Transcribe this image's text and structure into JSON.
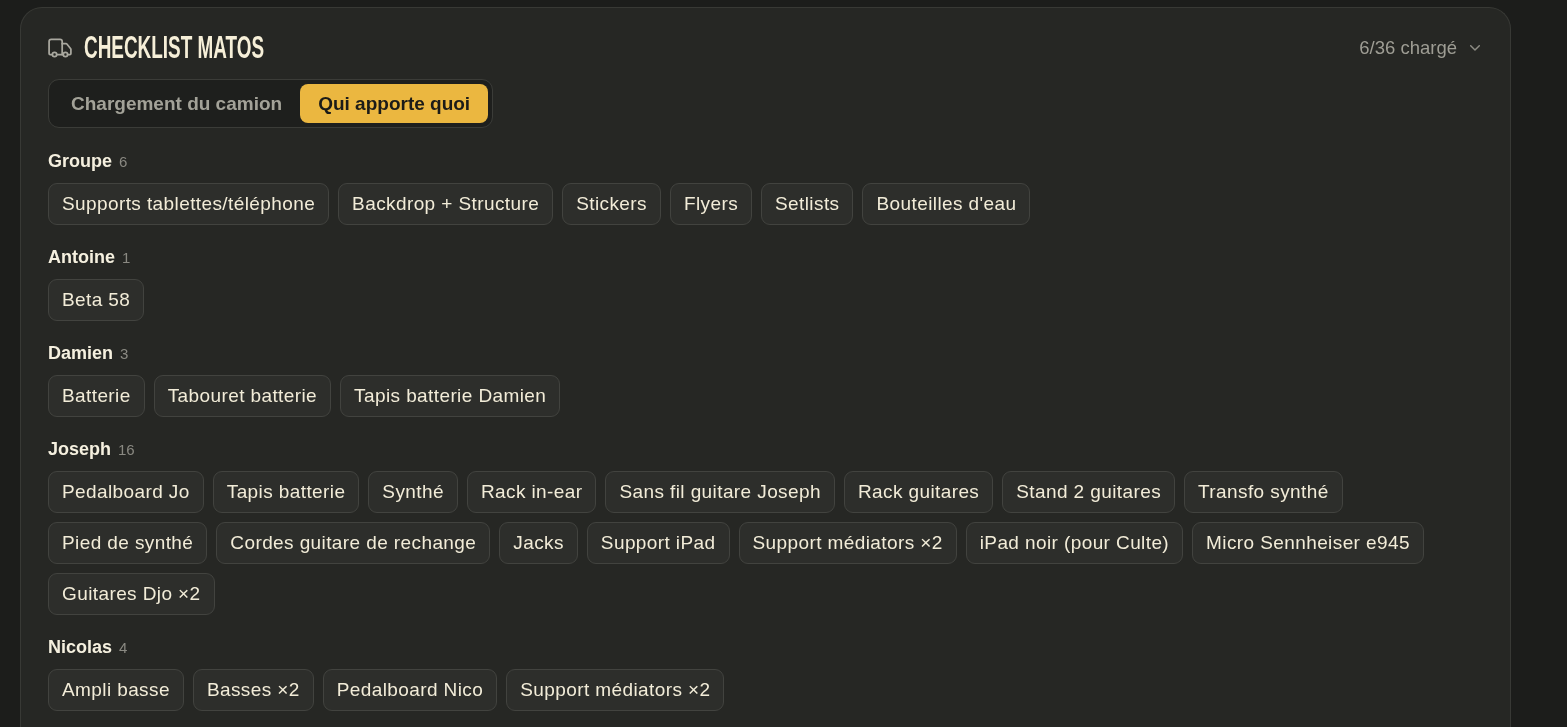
{
  "header": {
    "title": "CHECKLIST MATOS",
    "progress": "6/36 chargé"
  },
  "tabs": [
    {
      "label": "Chargement du camion",
      "selected": false
    },
    {
      "label": "Qui apporte quoi",
      "selected": true
    }
  ],
  "groups": [
    {
      "name": "Groupe",
      "count": "6",
      "items": [
        "Supports tablettes/téléphone",
        "Backdrop + Structure",
        "Stickers",
        "Flyers",
        "Setlists",
        "Bouteilles d'eau"
      ]
    },
    {
      "name": "Antoine",
      "count": "1",
      "items": [
        "Beta 58"
      ]
    },
    {
      "name": "Damien",
      "count": "3",
      "items": [
        "Batterie",
        "Tabouret batterie",
        "Tapis batterie Damien"
      ]
    },
    {
      "name": "Joseph",
      "count": "16",
      "items": [
        "Pedalboard Jo",
        "Tapis batterie",
        "Synthé",
        "Rack in-ear",
        "Sans fil guitare Joseph",
        "Rack guitares",
        "Stand 2 guitares",
        "Transfo synthé",
        "Pied de synthé",
        "Cordes guitare de rechange",
        "Jacks",
        "Support iPad",
        "Support médiators ×2",
        "iPad noir (pour Culte)",
        "Micro Sennheiser e945",
        "Guitares Djo ×2"
      ]
    },
    {
      "name": "Nicolas",
      "count": "4",
      "items": [
        "Ampli basse",
        "Basses ×2",
        "Pedalboard Nico",
        "Support médiators ×2"
      ]
    }
  ]
}
